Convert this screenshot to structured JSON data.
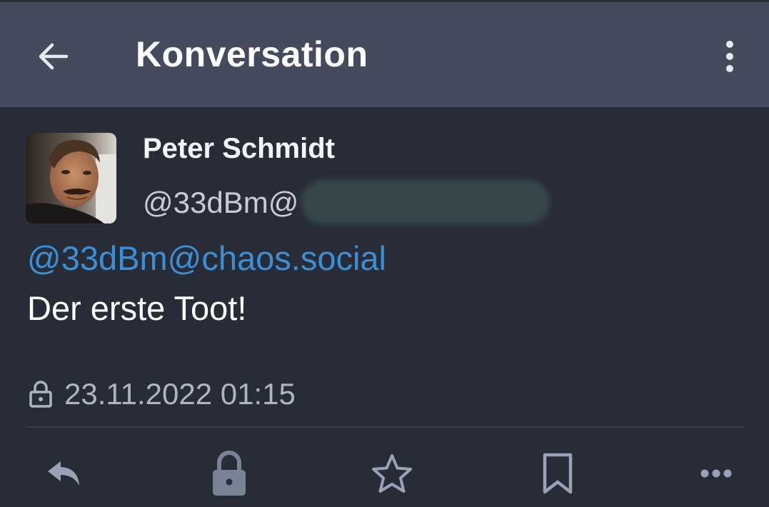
{
  "appbar": {
    "title": "Konversation",
    "back_icon": "arrow-left-icon",
    "overflow_icon": "more-vertical-icon"
  },
  "status": {
    "display_name": "Peter Schmidt",
    "handle_prefix": "@33dBm@",
    "mention": "@33dBm@chaos.social",
    "content": "Der erste Toot!",
    "visibility_icon": "lock-icon",
    "timestamp": "23.11.2022 01:15"
  },
  "actions": [
    {
      "name": "reply",
      "icon": "reply-icon"
    },
    {
      "name": "boost",
      "icon": "lock-icon"
    },
    {
      "name": "favourite",
      "icon": "star-icon"
    },
    {
      "name": "bookmark",
      "icon": "bookmark-icon"
    },
    {
      "name": "more",
      "icon": "more-horizontal-icon"
    }
  ],
  "colors": {
    "background": "#282c37",
    "appbar": "#444b5d",
    "mention": "#3a8fd6",
    "icon": "#aeb4c4"
  }
}
